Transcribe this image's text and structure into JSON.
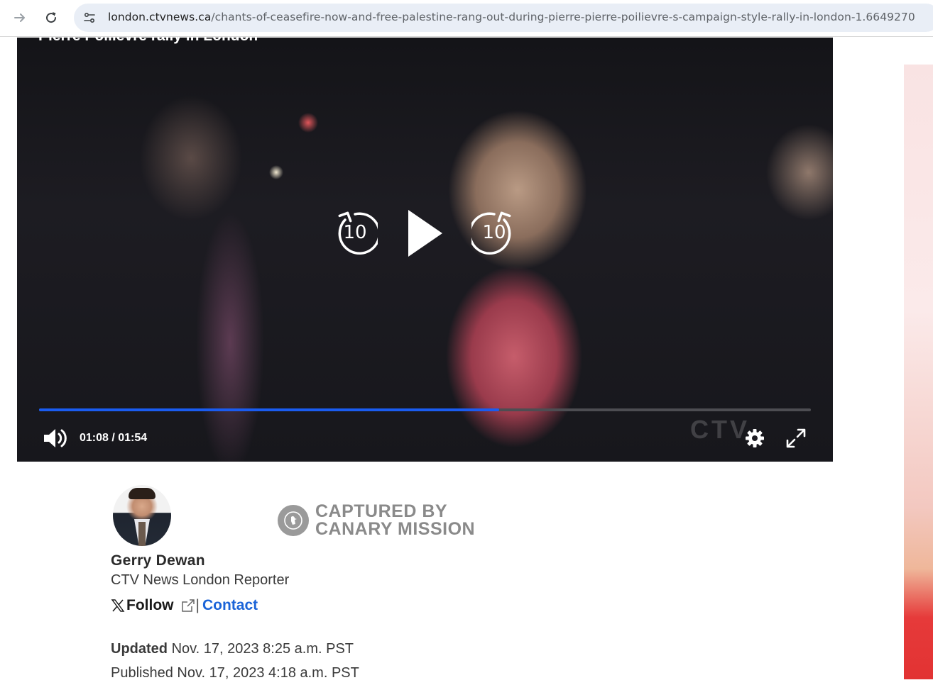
{
  "browser": {
    "url_domain": "london.ctvnews.ca",
    "url_path": "/chants-of-ceasefire-now-and-free-palestine-rang-out-during-pierre-pierre-poilievre-s-campaign-style-rally-in-london-1.6649270"
  },
  "video": {
    "title_fragment": "Pierre Poilievre rally in London",
    "watermark": "CTV",
    "skip_back_seconds": "10",
    "skip_forward_seconds": "10",
    "time_display": "01:08 / 01:54",
    "progress_fraction": 0.596,
    "accent_color": "#1a5cf0"
  },
  "byline": {
    "canary_line1": "CAPTURED BY",
    "canary_line2": "CANARY MISSION",
    "author_name": "Gerry Dewan",
    "author_role": "CTV News London Reporter",
    "follow_label": "Follow",
    "separator": "|",
    "contact_label": "Contact",
    "updated_label": "Updated",
    "updated_value": "Nov. 17, 2023 8:25 a.m. PST",
    "published_label": "Published",
    "published_value": "Nov. 17, 2023 4:18 a.m. PST"
  },
  "icons": [
    "forward-arrow-icon",
    "reload-icon",
    "site-info-icon",
    "rewind-10-icon",
    "play-icon",
    "forward-10-icon",
    "volume-icon",
    "settings-gear-icon",
    "fullscreen-icon",
    "x-logo-icon",
    "external-link-icon",
    "canary-bird-icon"
  ]
}
